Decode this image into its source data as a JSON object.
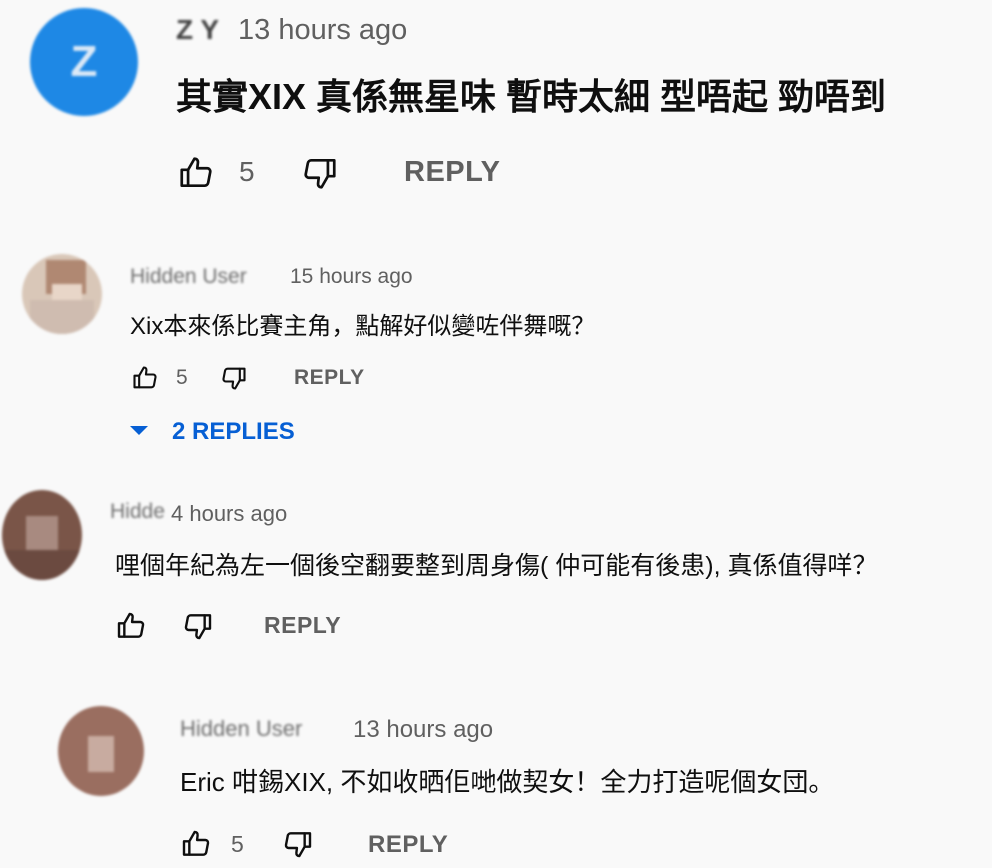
{
  "comments": [
    {
      "author": "Z Y",
      "time": "13 hours ago",
      "text": "其實XIX 真係無星味 暫時太細 型唔起 勁唔到",
      "likes": "5",
      "reply_label": "REPLY",
      "avatar_letter": "Z",
      "avatar_color": "#1e88e5"
    },
    {
      "author": "Hidden User",
      "time": "15 hours ago",
      "text": "Xix本來係比賽主角，點解好似變咗伴舞嘅？",
      "likes": "5",
      "reply_label": "REPLY",
      "replies_label": "2 REPLIES",
      "avatar_color": "#d6c2b4"
    },
    {
      "author": "Hidden",
      "time": "4 hours ago",
      "text": "哩個年紀為左一個後空翻要整到周身傷( 仲可能有後患), 真係值得咩？",
      "likes": "",
      "reply_label": "REPLY",
      "avatar_color": "#7a5548"
    },
    {
      "author": "Hidden User",
      "time": "13 hours ago",
      "text": "Eric 咁錫XIX, 不如收晒佢哋做契女！全力打造呢個女団。",
      "likes": "5",
      "reply_label": "REPLY",
      "avatar_color": "#9a6e60"
    }
  ],
  "colors": {
    "background": "#f9f9f9",
    "secondary_text": "#606060",
    "link_blue": "#065fd4"
  },
  "icons": [
    "thumb-up-icon",
    "thumb-down-icon",
    "chevron-down-icon"
  ]
}
